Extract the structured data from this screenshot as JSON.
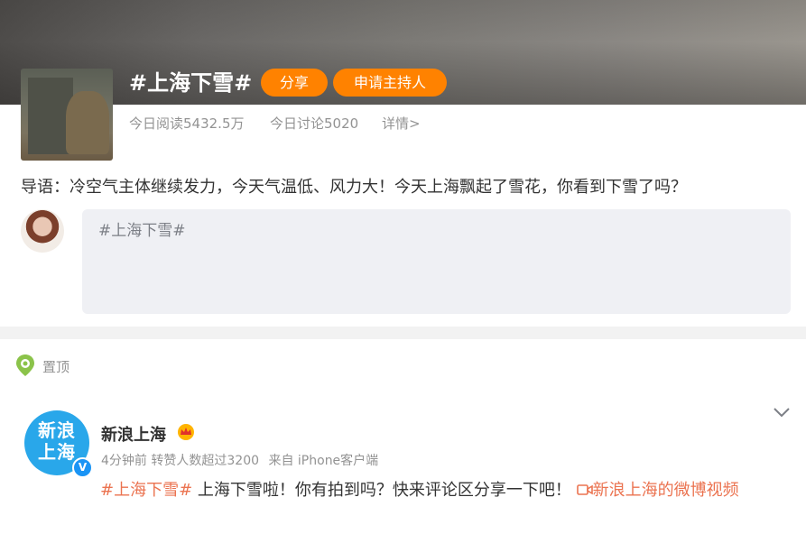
{
  "topic": {
    "title": "#上海下雪#",
    "share_label": "分享",
    "host_label": "申请主持人",
    "reads": "今日阅读5432.5万",
    "discussions": "今日讨论5020",
    "details": "详情>",
    "intro": "导语：冷空气主体继续发力，今天气温低、风力大！今天上海飘起了雪花，你看到下雪了吗？"
  },
  "composer": {
    "placeholder": "#上海下雪#"
  },
  "pinned": {
    "label": "置顶"
  },
  "post": {
    "author": "新浪上海",
    "avatar_text_line1": "新浪",
    "avatar_text_line2": "上海",
    "verified_badge": "V",
    "time": "4分钟前",
    "reposts": "转赞人数超过3200",
    "source": "来自 iPhone客户端",
    "hashtag": "#上海下雪#",
    "text": " 上海下雪啦！你有拍到吗？快来评论区分享一下吧！ ",
    "video_icon": "video-camera-icon",
    "video_link": "新浪上海的微博视频"
  },
  "colors": {
    "accent_orange": "#ff8200",
    "link_orange": "#eb7350",
    "composer_bg": "#eff0f4",
    "avatar_blue": "#29a7ea"
  }
}
